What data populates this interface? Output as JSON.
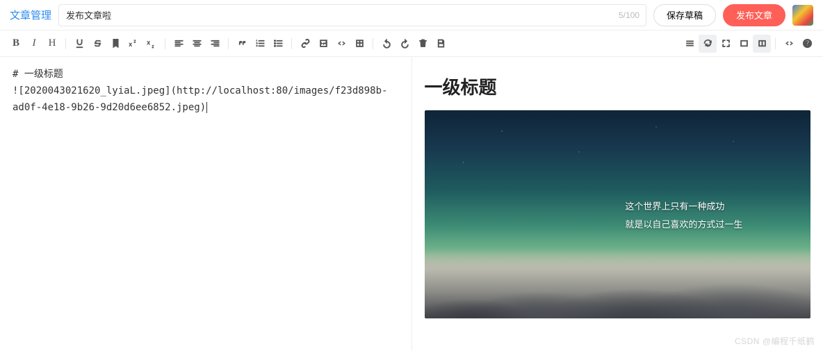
{
  "header": {
    "brand": "文章管理",
    "title_value": "发布文章啦",
    "title_placeholder": "",
    "counter": "5/100",
    "save_draft": "保存草稿",
    "publish": "发布文章"
  },
  "toolbar": {
    "bold": "B",
    "italic": "I",
    "heading": "H"
  },
  "editor": {
    "line1": "# 一级标题",
    "line2": "![2020043021620_lyiaL.jpeg](http://localhost:80/images/f23d898b-ad0f-4e18-9b26-9d20d6ee6852.jpeg)"
  },
  "preview": {
    "heading": "一级标题",
    "image_text_1": "这个世界上只有一种成功",
    "image_text_2": "就是以自己喜欢的方式过一生"
  },
  "watermark": "CSDN @编程千纸鹤"
}
